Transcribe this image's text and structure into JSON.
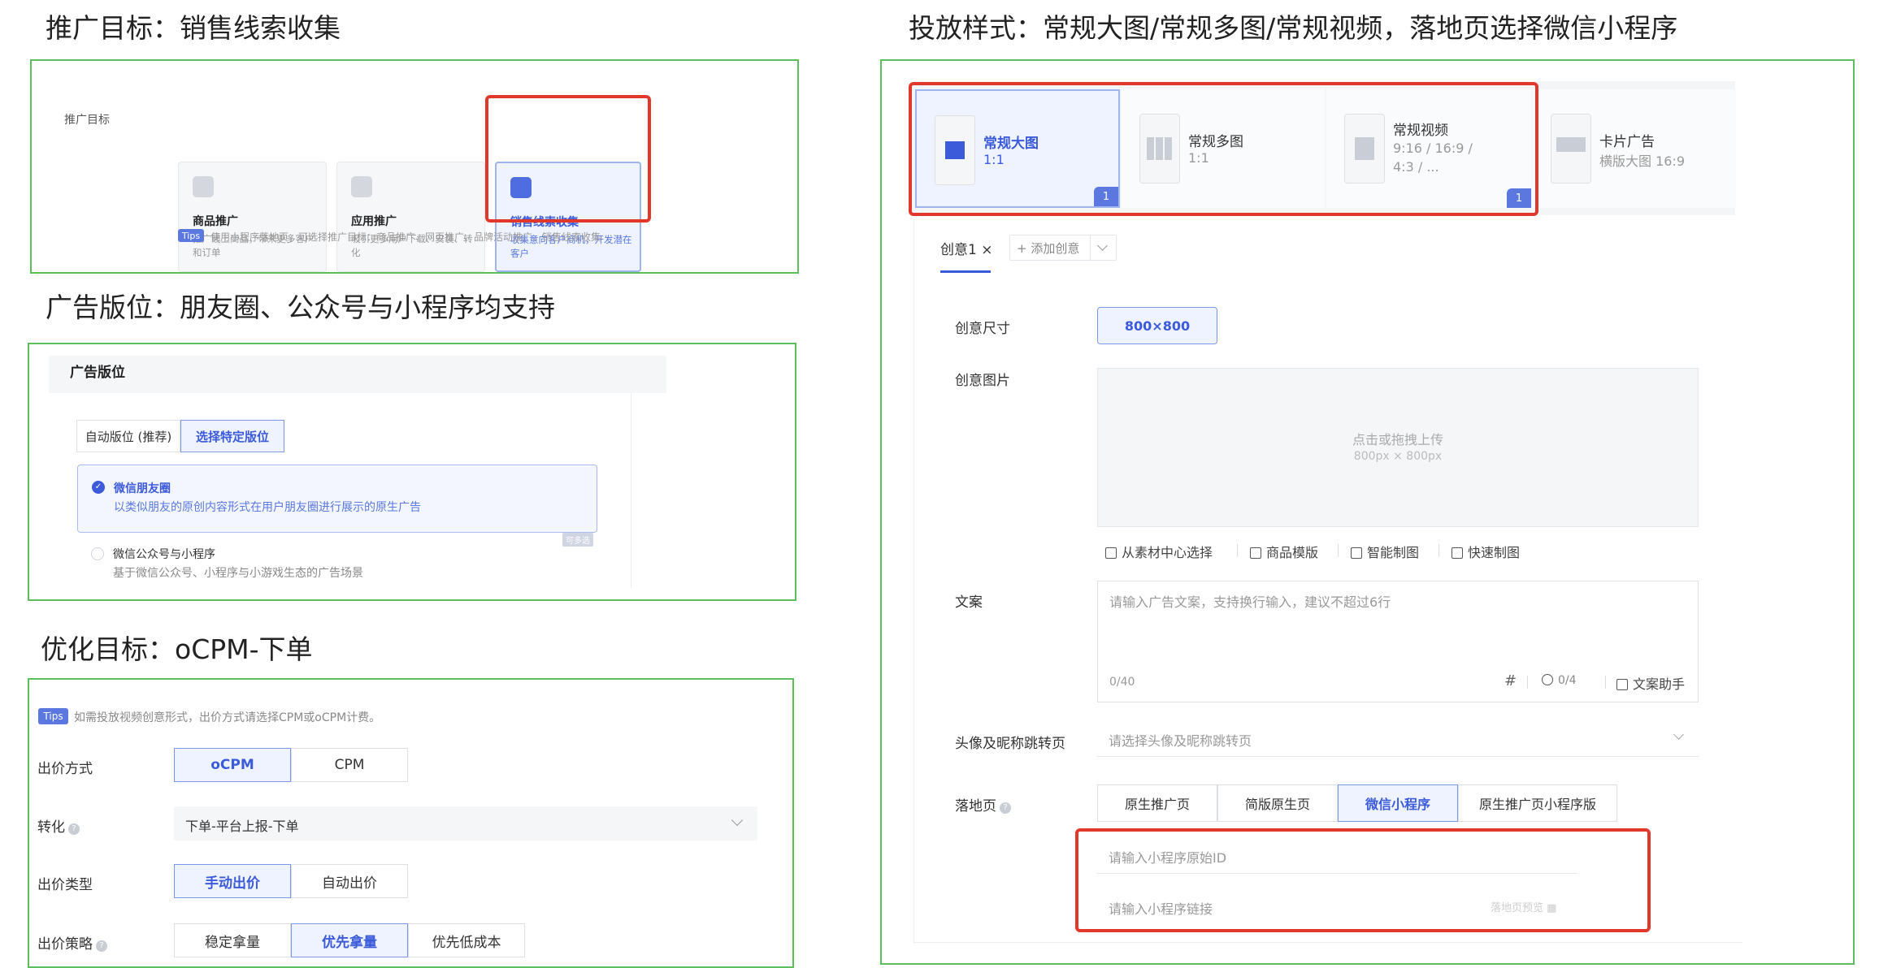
{
  "sections": {
    "promo_goal": {
      "heading": "推广目标：销售线索收集",
      "field_label": "推广目标",
      "cards": [
        {
          "title": "商品推广",
          "desc": "推广线上商品，带来更多客户和订单"
        },
        {
          "title": "应用推广",
          "desc": "吸引更多用户下载、安装、转化"
        },
        {
          "title": "销售线索收集",
          "desc": "收集意向客户商机，开发潜在客户"
        }
      ],
      "tips_badge": "Tips",
      "tips_text": "使用小程序落地页，可选择推广目标：商品推广、网页推广、品牌活动推广、销售线索收集"
    },
    "ad_placement": {
      "heading": "广告版位：朋友圈、公众号与小程序均支持",
      "panel_title": "广告版位",
      "tabs": [
        "自动版位 (推荐)",
        "选择特定版位"
      ],
      "options": [
        {
          "title": "微信朋友圈",
          "desc": "以类似朋友的原创内容形式在用户朋友圈进行展示的原生广告"
        },
        {
          "title": "微信公众号与小程序",
          "desc": "基于微信公众号、小程序与小游戏生态的广告场景"
        }
      ],
      "corner_tag": "可多选"
    },
    "optimization": {
      "heading": "优化目标：oCPM-下单",
      "tips_badge": "Tips",
      "tips_text": "如需投放视频创意形式，出价方式请选择CPM或oCPM计费。",
      "rows": {
        "bid_method": {
          "label": "出价方式",
          "options": [
            "oCPM",
            "CPM"
          ]
        },
        "conversion": {
          "label": "转化",
          "value": "下单-平台上报-下单"
        },
        "bid_type": {
          "label": "出价类型",
          "options": [
            "手动出价",
            "自动出价"
          ]
        },
        "bid_strategy": {
          "label": "出价策略",
          "options": [
            "稳定拿量",
            "优先拿量",
            "优先低成本"
          ]
        }
      }
    },
    "delivery": {
      "heading": "投放样式：常规大图/常规多图/常规视频，落地页选择微信小程序",
      "formats": [
        {
          "title": "常规大图",
          "sub": "1:1",
          "badge": "1"
        },
        {
          "title": "常规多图",
          "sub": "1:1"
        },
        {
          "title": "常规视频",
          "sub": "9:16 / 16:9 / 4:3 / ...",
          "badge": "1"
        },
        {
          "title": "卡片广告",
          "sub": "横版大图 16:9"
        }
      ],
      "creative_tab": "创意1",
      "close_glyph": "×",
      "add_creative": "添加创意",
      "form": {
        "size_label": "创意尺寸",
        "size_value": "800×800",
        "image_label": "创意图片",
        "upload_text": "点击或拖拽上传",
        "upload_sub": "800px × 800px",
        "tools": [
          "从素材中心选择",
          "商品模版",
          "智能制图",
          "快速制图"
        ],
        "copy_label": "文案",
        "copy_placeholder": "请输入广告文案，支持换行输入，建议不超过6行",
        "copy_count": "0/40",
        "hash_glyph": "#",
        "emoji_count": "0/4",
        "copy_helper": "文案助手",
        "avatar_label": "头像及昵称跳转页",
        "avatar_placeholder": "请选择头像及昵称跳转页",
        "landing_label": "落地页",
        "landing_options": [
          "原生推广页",
          "简版原生页",
          "微信小程序",
          "原生推广页小程序版"
        ],
        "mp_id_placeholder": "请输入小程序原始ID",
        "mp_link_placeholder": "请输入小程序链接",
        "preview_text": "落地页预览"
      }
    }
  },
  "colors": {
    "accent": "#3b5bdb",
    "green_frame": "#5cbf5c",
    "red_highlight": "#e2382b"
  }
}
